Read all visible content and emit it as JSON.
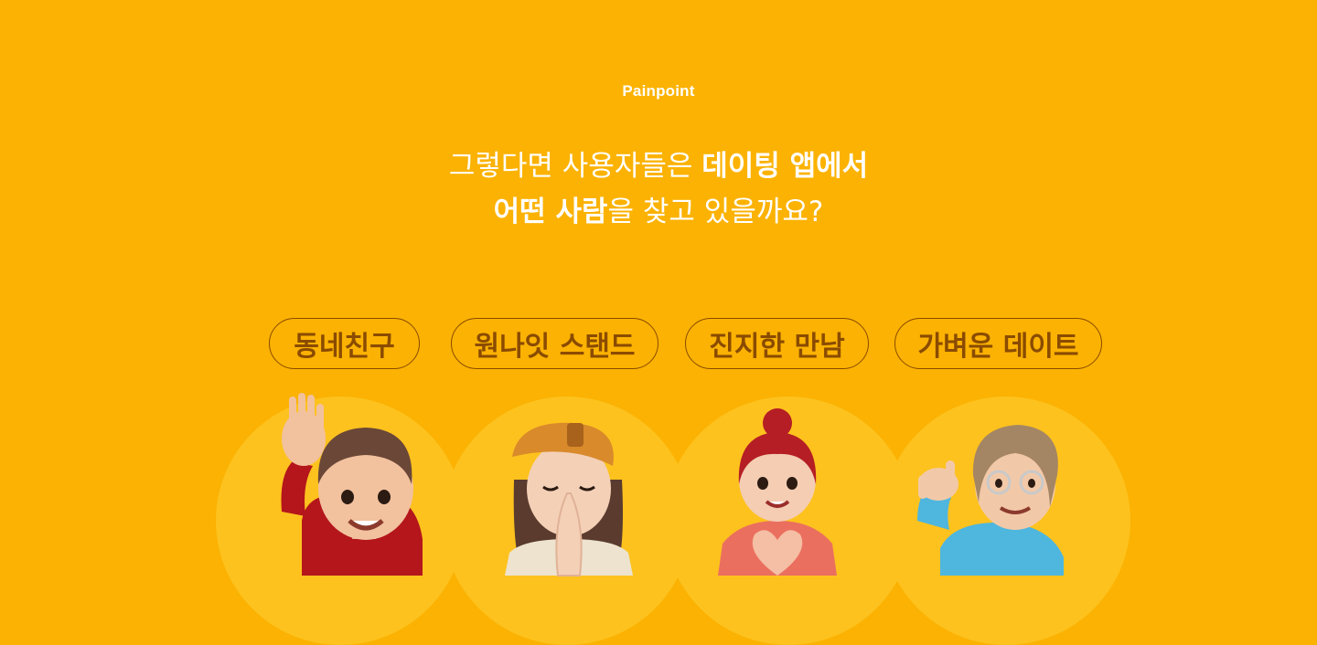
{
  "section": {
    "eyebrow": "Painpoint",
    "headline": {
      "line1_regular": "그렇다면 사용자들은 ",
      "line1_bold": "데이팅 앱에서",
      "line2_bold": "어떤 사람",
      "line2_regular": "을 찾고 있을까요?"
    }
  },
  "categories": [
    {
      "label": "동네친구",
      "avatar": "waving-boy-avatar"
    },
    {
      "label": "원나잇 스탠드",
      "avatar": "praying-girl-avatar"
    },
    {
      "label": "진지한 만남",
      "avatar": "heart-hands-girl-avatar"
    },
    {
      "label": "가벼운 데이트",
      "avatar": "shaka-man-avatar"
    }
  ],
  "colors": {
    "background": "#FBB202",
    "circle": "#FDC21E",
    "pill_text": "#8A4B00",
    "headline_text": "#FFFFFF"
  }
}
